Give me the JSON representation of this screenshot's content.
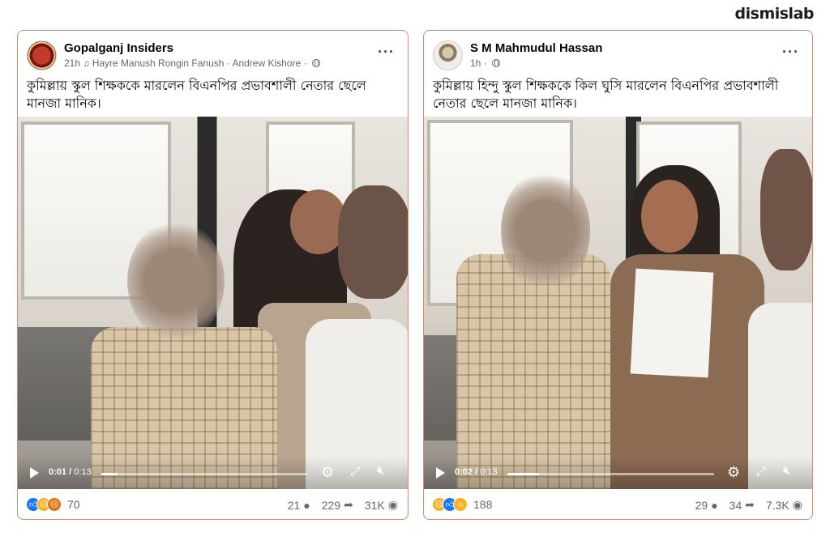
{
  "watermark": "dismislab",
  "posts": [
    {
      "page_name": "Gopalganj Insiders",
      "time": "21h",
      "music": "Hayre Manush Rongin Fanush · Andrew Kishore",
      "dot": "·",
      "caption": "কুমিল্লায় স্কুল শিক্ষককে মারলেন বিএনপির প্রভাবশালী নেতার ছেলে মানজা মানিক।",
      "video": {
        "current": "0:01",
        "duration": "0:13",
        "progress": 0.077
      },
      "reactions_count": "70",
      "comments": "21",
      "shares": "229",
      "views": "31K"
    },
    {
      "page_name": "S M Mahmudul Hassan",
      "time": "1h",
      "dot": "·",
      "caption": "কুমিল্লায় হিন্দু স্কুল শিক্ষককে কিল ঘুসি মারলেন  বিএনপির প্রভাবশালী নেতার ছেলে মানজা মানিক।",
      "video": {
        "current": "0:02",
        "duration": "0:13",
        "progress": 0.154
      },
      "reactions_count": "188",
      "comments": "29",
      "shares": "34",
      "views": "7.3K"
    }
  ],
  "icons": {
    "more": "more-icon",
    "globe": "globe-icon",
    "play": "play-icon",
    "settings": "gear-icon",
    "fullscreen": "expand-icon",
    "mute": "mute-icon",
    "comment": "comment-icon",
    "share": "share-icon",
    "views": "eye-icon"
  },
  "colors": {
    "card_border": "#d9876f",
    "like": "#1877f2",
    "reaction_yellow": "#f7b125",
    "angry": "#e9710f",
    "meta": "#65676b"
  }
}
